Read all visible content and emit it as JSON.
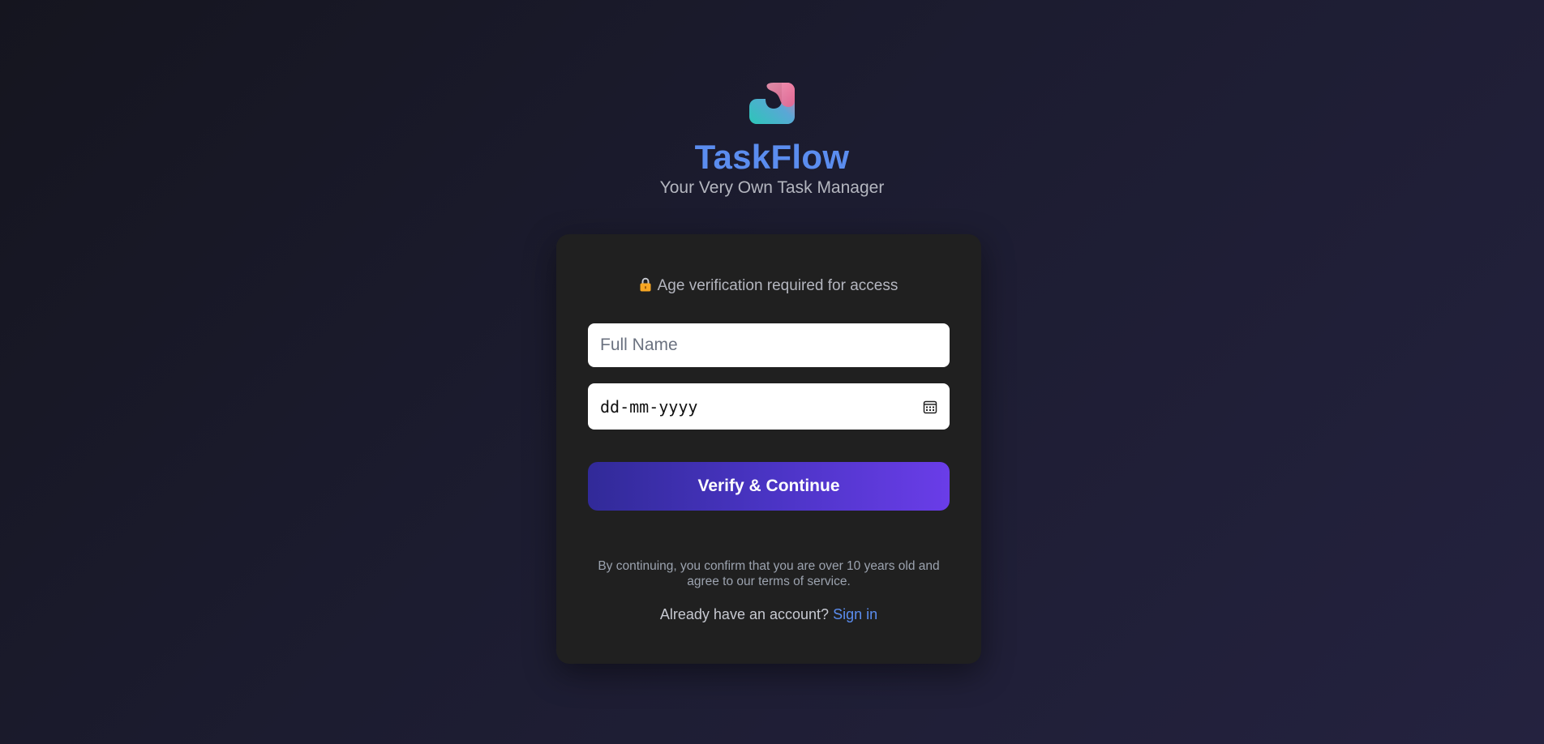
{
  "brand": {
    "title": "TaskFlow",
    "subtitle": "Your Very Own Task Manager",
    "logo_icon": "taskflow-logo-icon"
  },
  "card": {
    "notice_icon": "lock-icon",
    "notice_text": "Age verification required for access",
    "name_field": {
      "placeholder": "Full Name",
      "value": ""
    },
    "date_field": {
      "placeholder": "dd-mm-yyyy",
      "icon": "calendar-icon"
    },
    "verify_button_label": "Verify & Continue",
    "terms_text": "By continuing, you confirm that you are over 10 years old and agree to our terms of service.",
    "signin_prompt": "Already have an account?",
    "signin_link": "Sign in"
  },
  "colors": {
    "brand_blue": "#5b8def",
    "card_background": "#202020",
    "button_gradient_start": "#312a98",
    "button_gradient_end": "#6a3de8"
  }
}
